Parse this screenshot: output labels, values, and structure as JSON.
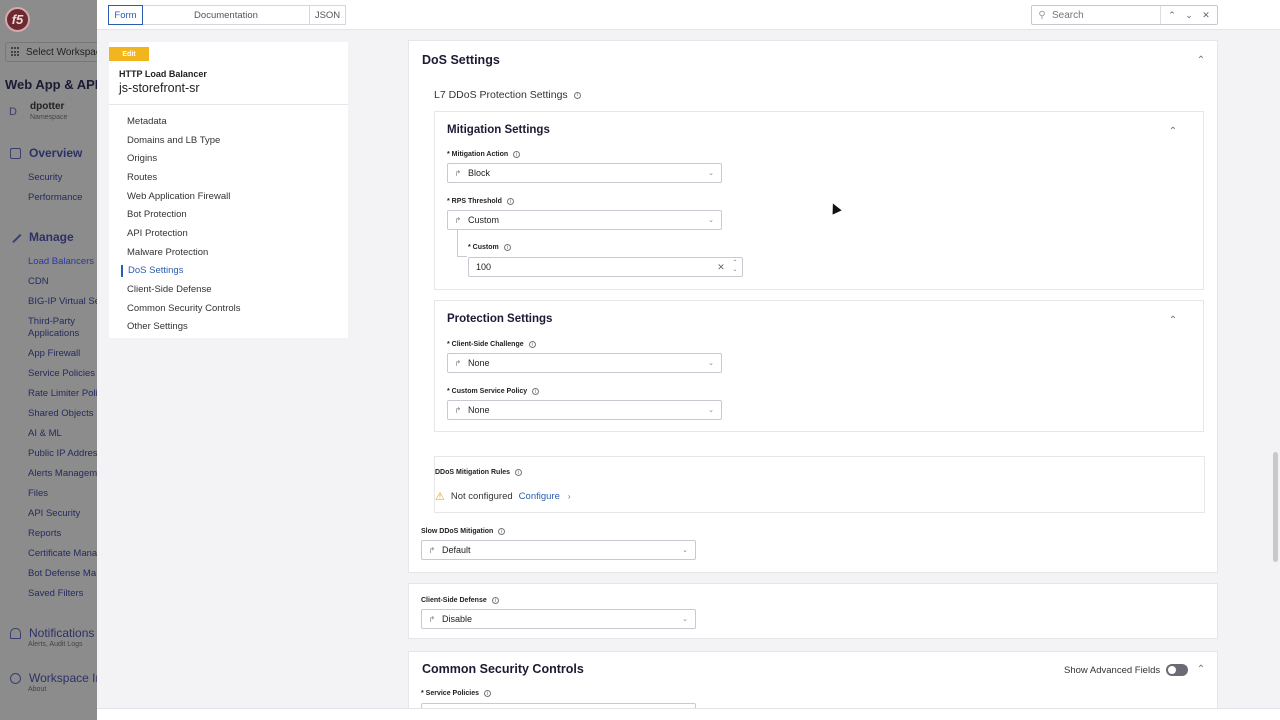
{
  "leftnav": {
    "workspace_select": "Select Workspace",
    "app_title": "Web App & API P",
    "namespace": {
      "avatar": "D",
      "name": "dpotter",
      "label": "Namespace"
    },
    "overview": {
      "label": "Overview",
      "items": [
        "Security",
        "Performance"
      ]
    },
    "manage": {
      "label": "Manage",
      "items": [
        "Load Balancers",
        "CDN",
        "BIG-IP Virtual Se",
        "Third-Party",
        "Applications",
        "App Firewall",
        "Service Policies",
        "Rate Limiter Polic",
        "Shared Objects",
        "AI & ML",
        "Public IP Address",
        "Alerts Managem",
        "Files",
        "API Security",
        "Reports",
        "Certificate Mana",
        "Bot Defense Ma",
        "Saved Filters"
      ]
    },
    "notifications": {
      "label": "Notifications",
      "sub": "Alerts, Audit Logs"
    },
    "workspace_info": {
      "label": "Workspace Inf",
      "sub": "About"
    }
  },
  "topbar": {
    "tabs": [
      {
        "label": "Form",
        "active": true
      },
      {
        "label": "Documentation",
        "active": false
      },
      {
        "label": "JSON",
        "active": false
      }
    ],
    "search_placeholder": "Search"
  },
  "toc": {
    "edit_label": "Edit",
    "object_type": "HTTP Load Balancer",
    "object_name": "js-storefront-sr",
    "items": [
      "Metadata",
      "Domains and LB Type",
      "Origins",
      "Routes",
      "Web Application Firewall",
      "Bot Protection",
      "API Protection",
      "Malware Protection",
      "DoS Settings",
      "Client-Side Defense",
      "Common Security Controls",
      "Other Settings"
    ],
    "active_item": "DoS Settings"
  },
  "dos": {
    "title": "DoS Settings",
    "l7_title": "L7 DDoS Protection Settings",
    "mitigation": {
      "title": "Mitigation Settings",
      "action_label": "Mitigation Action",
      "action_value": "Block",
      "rps_label": "RPS Threshold",
      "rps_value": "Custom",
      "custom_label": "Custom",
      "custom_value": "100"
    },
    "protection": {
      "title": "Protection Settings",
      "challenge_label": "Client-Side Challenge",
      "challenge_value": "None",
      "policy_label": "Custom Service Policy",
      "policy_value": "None"
    },
    "rules": {
      "label": "DDoS Mitigation Rules",
      "status": "Not configured",
      "configure": "Configure"
    },
    "slow": {
      "label": "Slow DDoS Mitigation",
      "value": "Default"
    }
  },
  "csd": {
    "label": "Client-Side Defense",
    "value": "Disable"
  },
  "csc": {
    "title": "Common Security Controls",
    "advanced_label": "Show Advanced Fields",
    "service_policies_label": "Service Policies"
  },
  "colors": {
    "accent": "#2a5db0",
    "edit_badge": "#f2b51d",
    "warning": "#e0a21a"
  }
}
